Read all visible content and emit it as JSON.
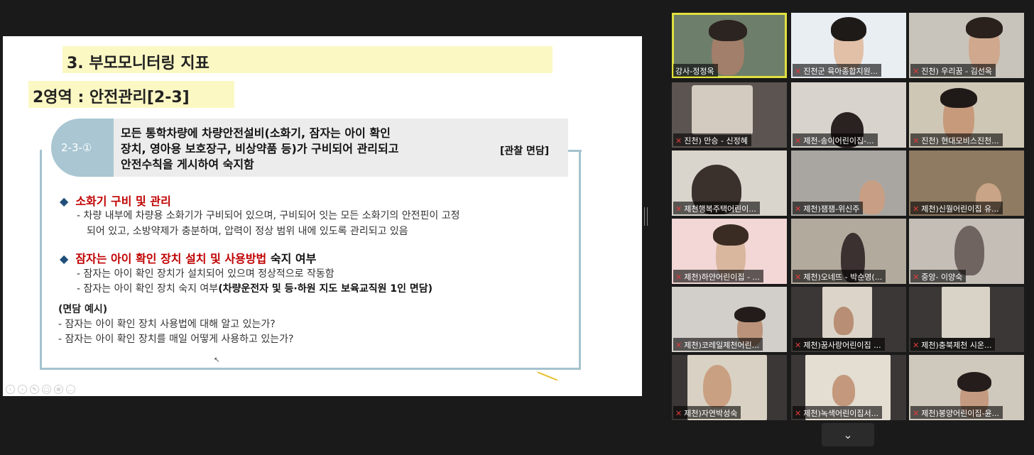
{
  "slide": {
    "title": "3. 부모모니터링 지표",
    "subtitle": "2영역 : 안전관리[2-3]",
    "criteria": {
      "badge": "2-3-①",
      "lines": [
        "모든 통학차량에 차량안전설비(소화기, 잠자는 아이 확인",
        "장치, 영아용 보호장구, 비상약품 등)가 구비되어 관리되고",
        "안전수칙을 게시하여 숙지함"
      ],
      "method": "[관찰 면담]"
    },
    "sections": [
      {
        "heading": "소화기 구비 및 관리",
        "heading_suffix": "",
        "lines": [
          "- 차량 내부에 차량용 소화기가 구비되어 있으며, 구비되어 잇는 모든 소화기의 안전핀이 고정",
          "되어 있고, 소방약제가 충분하며, 압력이 정상 범위 내에 있도록 관리되고 있음"
        ]
      },
      {
        "heading": "잠자는 아이 확인 장치 설치 및 사용방법",
        "heading_suffix": "숙지 여부",
        "lines": [
          "- 잠자는 아이 확인 장치가 설치되어 있으며 정상적으로 작동함",
          "- 잠자는 아이 확인 장치 숙지 여부"
        ],
        "bold_tail": "(차량운전자 및 등·하원 지도 보육교직원 1인 면담)"
      }
    ],
    "example": {
      "heading": "(면담 예시)",
      "lines": [
        "- 잠자는 아이 확인 장치 사용법에 대해 알고 있는가?",
        "- 잠자는 아이 확인 장치를 매일 어떻게 사용하고 있는가?"
      ]
    }
  },
  "participants": [
    {
      "name": "강사-정정옥",
      "muted": false,
      "active": true
    },
    {
      "name": "진천군 육아종합지원...",
      "muted": true,
      "active": false
    },
    {
      "name": "진천) 우리꿈 - 김선옥",
      "muted": true,
      "active": false
    },
    {
      "name": "진천) 만승 - 신정혜",
      "muted": true,
      "active": false
    },
    {
      "name": "제천-송이어린이집-...",
      "muted": true,
      "active": false
    },
    {
      "name": "진천) 현대모비스진천...",
      "muted": true,
      "active": false
    },
    {
      "name": "제천행복주택어린이...",
      "muted": true,
      "active": false
    },
    {
      "name": "제천)잼잼-위신주",
      "muted": true,
      "active": false
    },
    {
      "name": "제천)신월어린이집 유...",
      "muted": true,
      "active": false
    },
    {
      "name": "제천)하얀어린이집 - ...",
      "muted": true,
      "active": false
    },
    {
      "name": "제천)오네뜨 - 박순영(...",
      "muted": true,
      "active": false
    },
    {
      "name": "중앙- 이양숙",
      "muted": true,
      "active": false
    },
    {
      "name": "제천)코레일제천어린...",
      "muted": true,
      "active": false
    },
    {
      "name": "제천)꿈사랑어린이집 ...",
      "muted": true,
      "active": false
    },
    {
      "name": "제천)충북제천 시온...",
      "muted": true,
      "active": false
    },
    {
      "name": "제천)자연박성숙",
      "muted": true,
      "active": false
    },
    {
      "name": "제천)녹색어린이집서...",
      "muted": true,
      "active": false
    },
    {
      "name": "제천)봉양어린이집-윤...",
      "muted": true,
      "active": false
    }
  ],
  "controls": {
    "collapse_icon": "chevron-down-icon",
    "collapse_glyph": "⌄"
  },
  "colors": {
    "accent_highlight": "#e0e040",
    "muted_mic": "#e03a3a",
    "slide_title_bg": "#fcf8c4",
    "badge_bg": "#a9c6d2",
    "red_heading": "#c00000"
  }
}
